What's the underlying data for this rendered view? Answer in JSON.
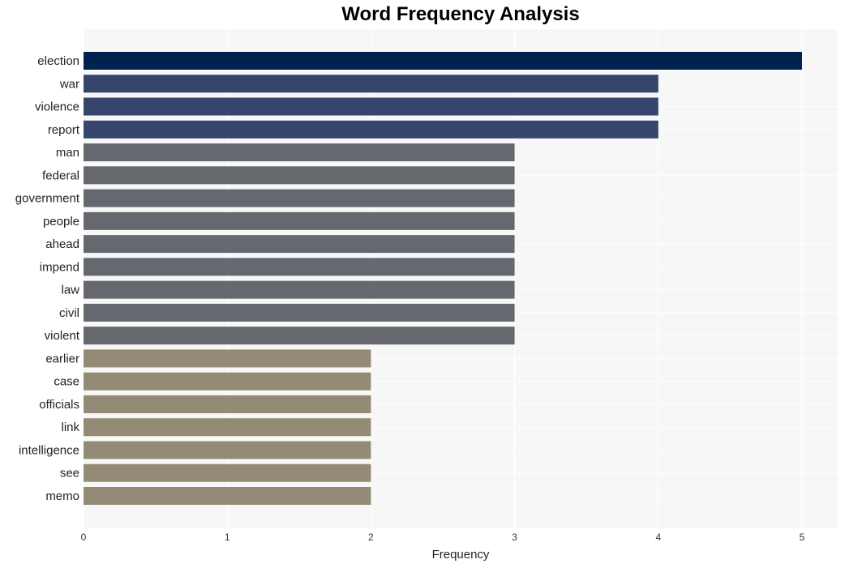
{
  "chart_data": {
    "type": "bar",
    "orientation": "horizontal",
    "title": "Word Frequency Analysis",
    "xlabel": "Frequency",
    "ylabel": "",
    "xlim": [
      0,
      5.25
    ],
    "xticks": [
      0,
      1,
      2,
      3,
      4,
      5
    ],
    "grid": true,
    "categories": [
      "election",
      "war",
      "violence",
      "report",
      "man",
      "federal",
      "government",
      "people",
      "ahead",
      "impend",
      "law",
      "civil",
      "violent",
      "earlier",
      "case",
      "officials",
      "link",
      "intelligence",
      "see",
      "memo"
    ],
    "values": [
      5,
      4,
      4,
      4,
      3,
      3,
      3,
      3,
      3,
      3,
      3,
      3,
      3,
      2,
      2,
      2,
      2,
      2,
      2,
      2
    ],
    "colors_by_value": {
      "5": "#00224e",
      "4": "#35456c",
      "3": "#666870",
      "2": "#948b77"
    },
    "background": "#f7f7f7"
  }
}
